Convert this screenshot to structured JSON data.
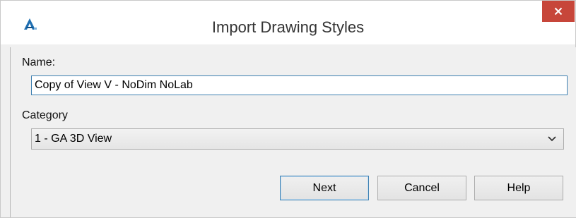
{
  "window": {
    "title": "Import Drawing Styles",
    "app_icon": "autocad-icon",
    "close_icon": "close-icon",
    "close_color": "#c7463a"
  },
  "form": {
    "name_label": "Name:",
    "name_value": "Copy of View V - NoDim NoLab",
    "category_label": "Category",
    "category_value": "1 - GA 3D View"
  },
  "buttons": {
    "next_label": "Next",
    "cancel_label": "Cancel",
    "help_label": "Help"
  },
  "colors": {
    "focus_border": "#3c7fb1",
    "dialog_background": "#f0f0f0"
  }
}
